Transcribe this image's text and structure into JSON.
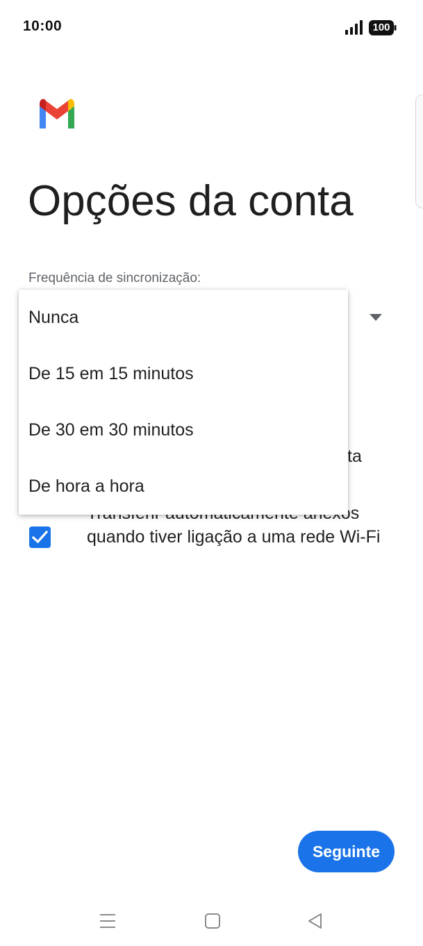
{
  "status_bar": {
    "time": "10:00",
    "battery": "100",
    "icons": [
      "signal-icon",
      "battery-icon"
    ]
  },
  "app": {
    "logo": "gmail-logo",
    "title": "Opções da conta"
  },
  "sync": {
    "label": "Frequência de sincronização:",
    "options": [
      "Nunca",
      "De 15 em 15 minutos",
      "De 30 em 30 minutos",
      "De hora a hora"
    ]
  },
  "background": {
    "partial_fragment": "ta",
    "attachments_option": {
      "label": "Transferir automaticamente anexos quando tiver ligação a uma rede Wi-Fi",
      "checked": true
    }
  },
  "actions": {
    "next_label": "Seguinte"
  },
  "nav_bar": {
    "icons": [
      "menu-icon",
      "home-icon",
      "back-icon"
    ]
  },
  "colors": {
    "accent": "#1a73e8",
    "gmail_red": "#ea4335",
    "gmail_blue": "#4285f4",
    "gmail_green": "#34a853",
    "gmail_yellow": "#fbbc04",
    "gmail_darkred": "#c5221f"
  }
}
